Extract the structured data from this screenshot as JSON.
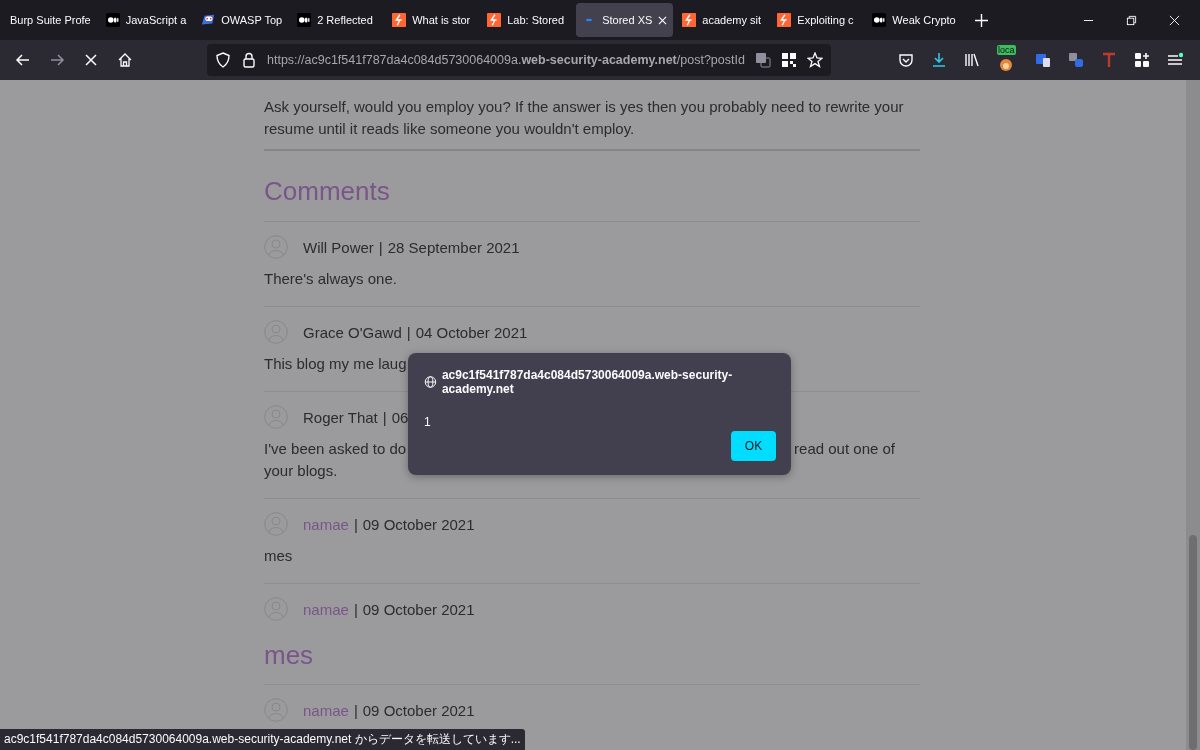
{
  "tabs": [
    {
      "label": "Burp Suite Profe",
      "selected": false
    },
    {
      "label": "JavaScript a",
      "selected": false
    },
    {
      "label": "OWASP Top",
      "selected": false
    },
    {
      "label": "2 Reflected",
      "selected": false
    },
    {
      "label": "What is stor",
      "selected": false
    },
    {
      "label": "Lab: Stored",
      "selected": false
    },
    {
      "label": "Stored XS",
      "selected": true
    },
    {
      "label": "academy sit",
      "selected": false
    },
    {
      "label": "Exploiting c",
      "selected": false
    },
    {
      "label": "Weak Crypto",
      "selected": false
    }
  ],
  "address_bar": {
    "url": "https://ac9c1f541f787da4c084d5730064009a.**web-security-academy.net**/post?postId"
  },
  "extension_badge": "loca",
  "page": {
    "paragraph_lines": [
      "Ask yourself, would you employ you? If the answer is yes then you probably need to rewrite your",
      "resume until it reads like someone you wouldn't employ."
    ],
    "comments_heading": "Comments",
    "comments": [
      {
        "author": "Will Power",
        "linked": false,
        "separator": "|",
        "date": "28 September 2021",
        "kind": "text",
        "lines": [
          [
            "There's always one."
          ]
        ]
      },
      {
        "author": "Grace O'Gawd",
        "linked": false,
        "separator": "|",
        "date": "04 October 2021",
        "kind": "text",
        "lines": [
          [
            "This blog my me laug"
          ]
        ]
      },
      {
        "author": "Roger That",
        "linked": false,
        "separator": "|",
        "date": "06",
        "kind": "text",
        "lines": [
          [
            "I've been asked to do",
            "read out one of"
          ],
          [
            "your blogs."
          ]
        ]
      },
      {
        "author": "namae",
        "linked": true,
        "separator": "|",
        "date": "09 October 2021",
        "kind": "text",
        "lines": [
          [
            "mes"
          ]
        ]
      },
      {
        "author": "namae",
        "linked": true,
        "separator": "|",
        "date": "09 October 2021",
        "kind": "heading",
        "lines": [
          [
            "mes"
          ]
        ]
      },
      {
        "author": "namae",
        "linked": true,
        "separator": "|",
        "date": "09 October 2021"
      }
    ]
  },
  "dialog": {
    "origin": "ac9c1f541f787da4c084d5730064009a.web-security-academy.net",
    "message": "1",
    "button": "OK"
  },
  "status_bar": "ac9c1f541f787da4c084d5730064009a.web-security-academy.net からデータを転送しています..."
}
